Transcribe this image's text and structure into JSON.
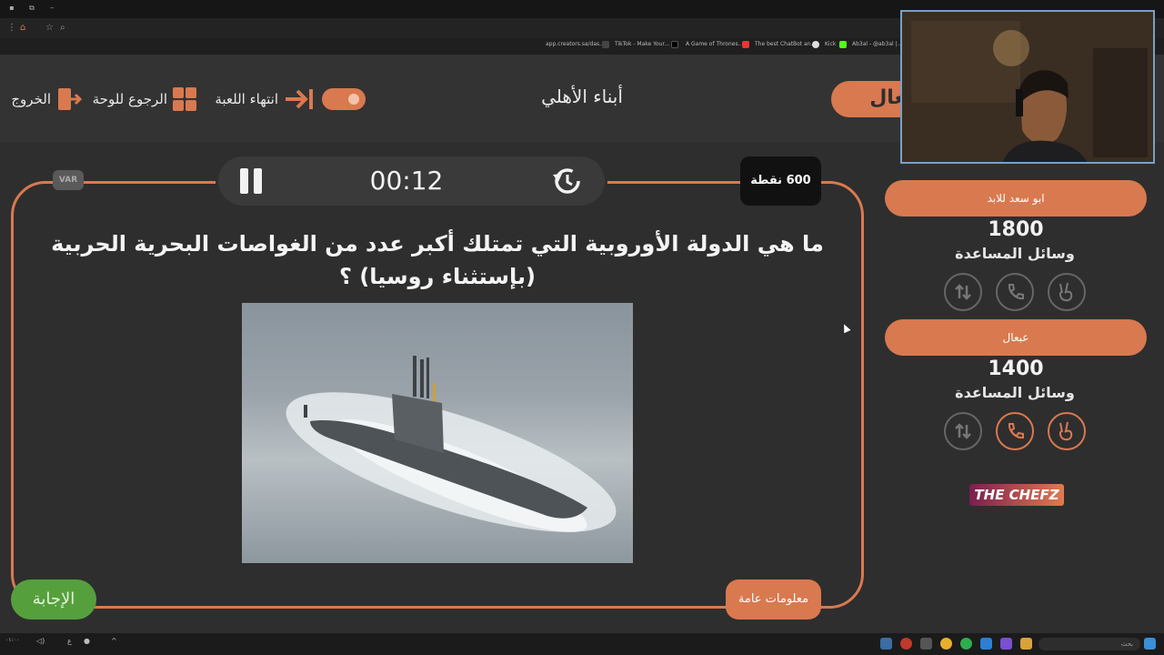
{
  "browser": {
    "bookmarks": [
      "app.creators.sa/das...",
      "TikTok - Make Your...",
      "A Game of Thrones...",
      "The best ChatBot an...",
      "Kick",
      "Ab3al - @ab3al |..."
    ]
  },
  "header": {
    "exit_label": "الخروج",
    "back_label": "الرجوع للوحة",
    "end_game_label": "انتهاء اللعبة",
    "title": "أبناء الأهلي",
    "team_chip": "عبعال"
  },
  "question": {
    "timer": "00:12",
    "points": "600 نقطة",
    "var_label": "VAR",
    "text_line1": "ما هي الدولة الأوروبية التي تمتلك أكبر عدد من الغواصات البحرية الحربية",
    "text_line2": "(بإستثناء روسيا) ؟",
    "image_subject": "submarine",
    "category": "معلومات عامة",
    "answer_label": "الإجابة"
  },
  "teams": [
    {
      "name": "ابو سعد للابد",
      "score": "1800",
      "aids_label": "وسائل المساعدة",
      "aids_active": [
        false,
        false,
        false
      ]
    },
    {
      "name": "عبعال",
      "score": "1400",
      "aids_label": "وسائل المساعدة",
      "aids_active": [
        false,
        true,
        true
      ]
    }
  ],
  "aid_icons": [
    "swap-icon",
    "phone-icon",
    "peace-hand-icon"
  ],
  "brand": "THE CHEFZ",
  "taskbar": {
    "search_placeholder": "بحث",
    "lang": "ع"
  },
  "colors": {
    "accent": "#d9794f",
    "background": "#2e2e2e",
    "answer_green": "#55a03c"
  }
}
